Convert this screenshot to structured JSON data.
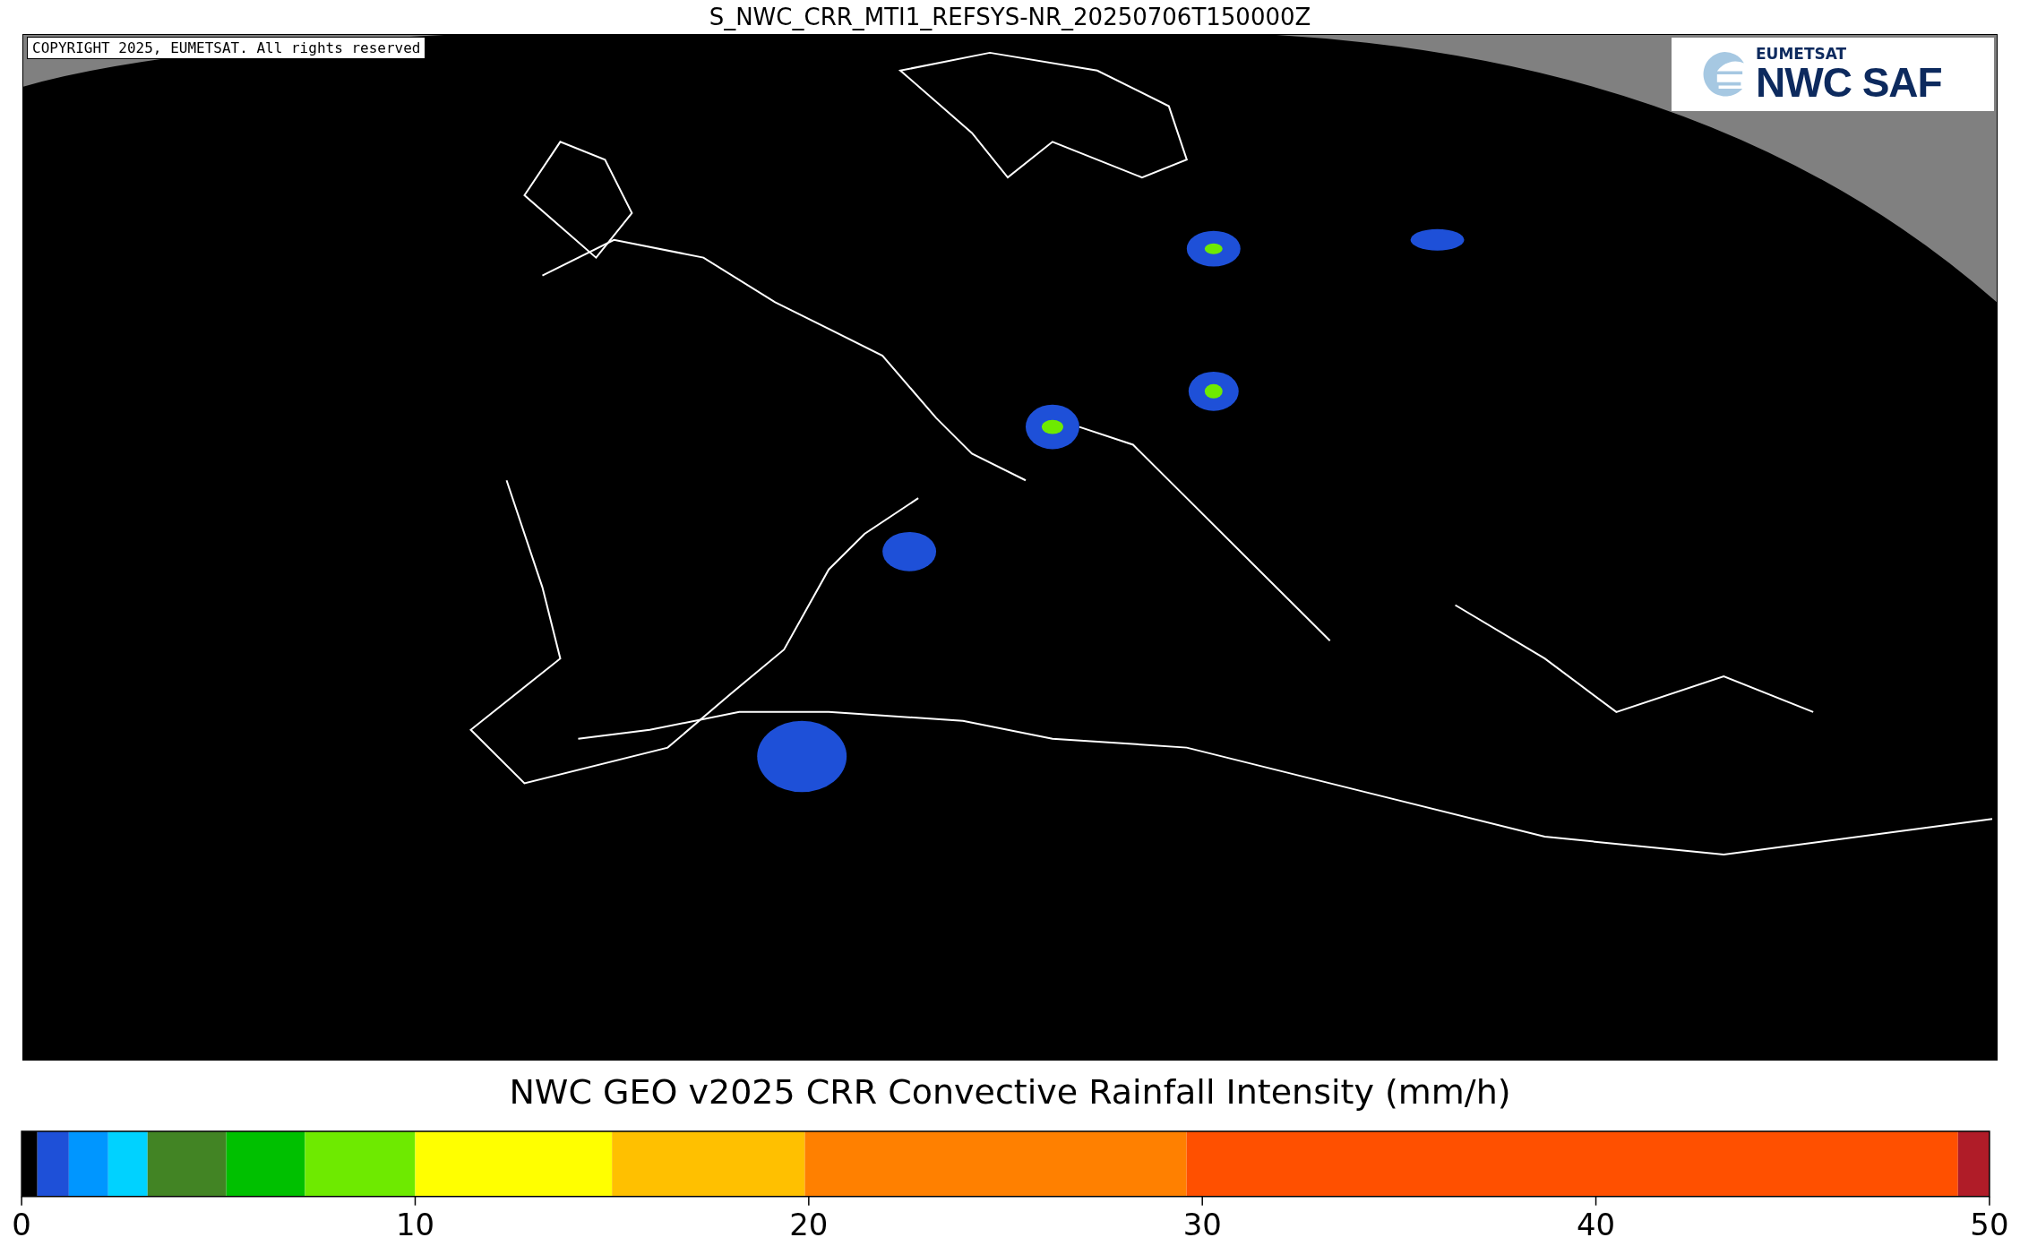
{
  "figure": {
    "title": "S_NWC_CRR_MTI1_REFSYS-NR_20250706T150000Z"
  },
  "map": {
    "copyright": "COPYRIGHT 2025, EUMETSAT. All rights reserved",
    "logo": {
      "top_text": "EUMETSAT",
      "main_text": "NWC SAF"
    }
  },
  "colorbar": {
    "chart_data": {
      "type": "bar",
      "title": "NWC GEO v2025 CRR Convective Rainfall Intensity (mm/h)",
      "orientation": "horizontal",
      "stacked": true,
      "series": [
        {
          "color": "#000000",
          "values": [
            0.4
          ]
        },
        {
          "color": "#1e50d8",
          "values": [
            0.8
          ]
        },
        {
          "color": "#0096ff",
          "values": [
            1.0
          ]
        },
        {
          "color": "#00d2ff",
          "values": [
            1.0
          ]
        },
        {
          "color": "#428424",
          "values": [
            2.0
          ]
        },
        {
          "color": "#00c000",
          "values": [
            2.0
          ]
        },
        {
          "color": "#6eea00",
          "values": [
            2.8
          ]
        },
        {
          "color": "#ffff00",
          "values": [
            5.0
          ]
        },
        {
          "color": "#ffc000",
          "values": [
            4.9
          ]
        },
        {
          "color": "#ff8000",
          "values": [
            9.7
          ]
        },
        {
          "color": "#ff5000",
          "values": [
            19.6
          ]
        },
        {
          "color": "#b01c28",
          "values": [
            0.8
          ]
        }
      ],
      "xlim": [
        0,
        50
      ],
      "xticks": [
        0,
        10,
        20,
        30,
        40,
        50
      ]
    }
  }
}
